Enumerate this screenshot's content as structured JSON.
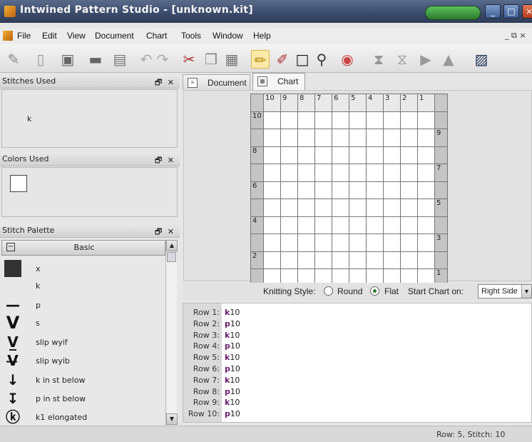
{
  "window": {
    "title": "Intwined Pattern Studio - [unknown.kit]"
  },
  "menubar": {
    "items": [
      "File",
      "Edit",
      "View",
      "Document",
      "Chart",
      "Tools",
      "Window",
      "Help"
    ],
    "mdi_controls": "_ ⧉ ×"
  },
  "toolbar": {
    "tools": [
      "eraser-icon",
      "new-document-icon",
      "save-icon",
      "print-icon",
      "pdf-icon",
      "undo-icon",
      "redo-icon",
      "cut-icon",
      "copy-icon",
      "paste-icon",
      "pencil-icon",
      "paint-icon",
      "rectangle-select-icon",
      "lasso-icon",
      "color-wheel-icon",
      "flip-vertical-icon",
      "flip-horizontal-icon",
      "play-icon",
      "mirror-icon",
      "image-icon"
    ],
    "selected": "pencil-icon"
  },
  "stitches_used": {
    "title": "Stitches Used",
    "controls": "🗗 ✕",
    "items": [
      "k"
    ]
  },
  "colors_used": {
    "title": "Colors Used",
    "controls": "🗗 ✕",
    "swatch_color": "#ffffff"
  },
  "stitch_palette": {
    "title": "Stitch Palette",
    "controls": "🗗 ✕",
    "group": "Basic",
    "items": [
      {
        "symbol": "■",
        "label": "x"
      },
      {
        "symbol": "",
        "label": "k"
      },
      {
        "symbol": "—",
        "label": "p"
      },
      {
        "symbol": "V",
        "label": "s"
      },
      {
        "symbol": "V̲",
        "label": "slip wyif"
      },
      {
        "symbol": "V̶",
        "label": "slip wyib"
      },
      {
        "symbol": "↓",
        "label": "k in st below"
      },
      {
        "symbol": "↧",
        "label": "p in st below"
      },
      {
        "symbol": "ⓚ",
        "label": "k1 elongated"
      }
    ]
  },
  "tabs": [
    {
      "label": "Document",
      "active": false
    },
    {
      "label": "Chart",
      "active": true
    }
  ],
  "chart": {
    "column_numbers": [
      "10",
      "9",
      "8",
      "7",
      "6",
      "5",
      "4",
      "3",
      "2",
      "1"
    ],
    "left_row_numbers": [
      "10",
      "",
      "8",
      "",
      "6",
      "",
      "4",
      "",
      "2",
      ""
    ],
    "right_row_numbers": [
      "",
      "9",
      "",
      "7",
      "",
      "5",
      "",
      "3",
      "",
      "1"
    ]
  },
  "knitting_style": {
    "label": "Knitting Style:",
    "option_round": "Round",
    "option_flat": "Flat",
    "selected": "Flat",
    "start_label": "Start Chart on:",
    "start_value": "Right Side"
  },
  "rows": [
    {
      "label": "Row 1:",
      "stitch": "k",
      "count": "10"
    },
    {
      "label": "Row 2:",
      "stitch": "p",
      "count": "10"
    },
    {
      "label": "Row 3:",
      "stitch": "k",
      "count": "10"
    },
    {
      "label": "Row 4:",
      "stitch": "p",
      "count": "10"
    },
    {
      "label": "Row 5:",
      "stitch": "k",
      "count": "10"
    },
    {
      "label": "Row 6:",
      "stitch": "p",
      "count": "10"
    },
    {
      "label": "Row 7:",
      "stitch": "k",
      "count": "10"
    },
    {
      "label": "Row 8:",
      "stitch": "p",
      "count": "10"
    },
    {
      "label": "Row 9:",
      "stitch": "k",
      "count": "10"
    },
    {
      "label": "Row 10:",
      "stitch": "p",
      "count": "10"
    }
  ],
  "status": {
    "text": "Row: 5, Stitch: 10"
  }
}
